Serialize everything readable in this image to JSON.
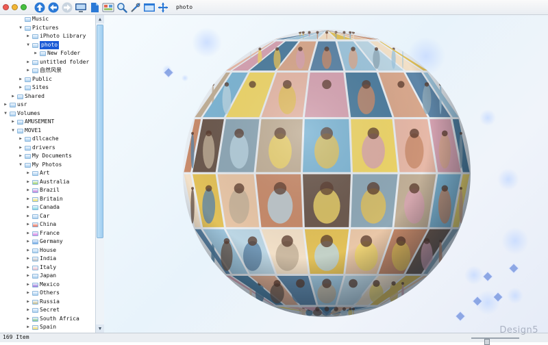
{
  "toolbar": {
    "folder_label": "photo",
    "window_controls": [
      {
        "name": "close-control",
        "color": "#ee5a52"
      },
      {
        "name": "minimize-control",
        "color": "#f2b533"
      },
      {
        "name": "zoom-control",
        "color": "#45c03e"
      }
    ],
    "buttons": [
      {
        "name": "up-arrow-icon",
        "interactable": true
      },
      {
        "name": "back-arrow-icon",
        "interactable": true
      },
      {
        "name": "forward-arrow-icon",
        "interactable": true
      },
      {
        "name": "monitor-view-icon",
        "interactable": true
      },
      {
        "name": "document-view-icon",
        "interactable": true
      },
      {
        "name": "slideshow-icon",
        "interactable": true
      },
      {
        "name": "magnifier-icon",
        "interactable": true
      },
      {
        "name": "tools-icon",
        "interactable": true
      },
      {
        "name": "window-icon",
        "interactable": true
      },
      {
        "name": "expand-icon",
        "interactable": true
      }
    ]
  },
  "tree": {
    "items": [
      {
        "label": "Music",
        "depth": 2,
        "state": "none",
        "color": "#a9cfee"
      },
      {
        "label": "Pictures",
        "depth": 2,
        "state": "expanded",
        "color": "#a9cfee"
      },
      {
        "label": "iPhoto Library",
        "depth": 3,
        "state": "collapsed",
        "color": "#a9cfee"
      },
      {
        "label": "photo",
        "depth": 3,
        "state": "expanded",
        "color": "#a9cfee",
        "selected": true
      },
      {
        "label": "New Folder",
        "depth": 4,
        "state": "collapsed",
        "color": "#a9cfee"
      },
      {
        "label": "untitled folder",
        "depth": 3,
        "state": "collapsed",
        "color": "#a9cfee"
      },
      {
        "label": "自然风景",
        "depth": 3,
        "state": "collapsed",
        "color": "#a9cfee"
      },
      {
        "label": "Public",
        "depth": 2,
        "state": "collapsed",
        "color": "#a9cfee"
      },
      {
        "label": "Sites",
        "depth": 2,
        "state": "collapsed",
        "color": "#a9cfee"
      },
      {
        "label": "Shared",
        "depth": 1,
        "state": "collapsed",
        "color": "#a9cfee"
      },
      {
        "label": "usr",
        "depth": 0,
        "state": "collapsed",
        "color": "#a9cfee"
      },
      {
        "label": "Volumes",
        "depth": 0,
        "state": "expanded",
        "color": "#a9cfee"
      },
      {
        "label": "AMUSEMENT",
        "depth": 1,
        "state": "collapsed",
        "color": "#a9cfee"
      },
      {
        "label": "MOVE1",
        "depth": 1,
        "state": "expanded",
        "color": "#a9cfee"
      },
      {
        "label": "dllcache",
        "depth": 2,
        "state": "collapsed",
        "color": "#a9cfee"
      },
      {
        "label": "drivers",
        "depth": 2,
        "state": "collapsed",
        "color": "#a9cfee"
      },
      {
        "label": "My Documents",
        "depth": 2,
        "state": "collapsed",
        "color": "#a9cfee"
      },
      {
        "label": "My Photos",
        "depth": 2,
        "state": "expanded",
        "color": "#a9cfee"
      },
      {
        "label": "Art",
        "depth": 3,
        "state": "collapsed",
        "color": "#a9cfee"
      },
      {
        "label": "Australia",
        "depth": 3,
        "state": "collapsed",
        "color": "#9fd26a"
      },
      {
        "label": "Brazil",
        "depth": 3,
        "state": "collapsed",
        "color": "#c57ad8"
      },
      {
        "label": "Britain",
        "depth": 3,
        "state": "collapsed",
        "color": "#f0e06a"
      },
      {
        "label": "Canada",
        "depth": 3,
        "state": "collapsed",
        "color": "#7fd6de"
      },
      {
        "label": "Car",
        "depth": 3,
        "state": "collapsed",
        "color": "#a9cfee"
      },
      {
        "label": "China",
        "depth": 3,
        "state": "collapsed",
        "color": "#ef6a4e"
      },
      {
        "label": "France",
        "depth": 3,
        "state": "collapsed",
        "color": "#d97ee0"
      },
      {
        "label": "Germany",
        "depth": 3,
        "state": "collapsed",
        "color": "#6fa8e6"
      },
      {
        "label": "House",
        "depth": 3,
        "state": "collapsed",
        "color": "#a9cfee"
      },
      {
        "label": "India",
        "depth": 3,
        "state": "collapsed",
        "color": "#bfbfbf"
      },
      {
        "label": "Italy",
        "depth": 3,
        "state": "collapsed",
        "color": "#f2c0c8"
      },
      {
        "label": "Japan",
        "depth": 3,
        "state": "collapsed",
        "color": "#a9cfee"
      },
      {
        "label": "Mexico",
        "depth": 3,
        "state": "collapsed",
        "color": "#9a6fd8"
      },
      {
        "label": "Others",
        "depth": 3,
        "state": "collapsed",
        "color": "#a9cfee"
      },
      {
        "label": "Russia",
        "depth": 3,
        "state": "collapsed",
        "color": "#c8bd8a"
      },
      {
        "label": "Secret",
        "depth": 3,
        "state": "collapsed",
        "color": "#a9cfee"
      },
      {
        "label": "South Africa",
        "depth": 3,
        "state": "collapsed",
        "color": "#7fc48a"
      },
      {
        "label": "Spain",
        "depth": 3,
        "state": "collapsed",
        "color": "#f0d86a"
      }
    ]
  },
  "status": {
    "item_count": "169 Item",
    "zoom_level": 0.3,
    "watermark": "Design5"
  },
  "viewer": {
    "tile_palette": [
      "#d9a98e",
      "#7fb7d6",
      "#e9c7a8",
      "#5e86a8",
      "#f0d76a",
      "#c98c6c",
      "#9fc6dd",
      "#e7b9a8",
      "#6d5a4f",
      "#bcd6e4",
      "#d7a4b3",
      "#8fa9b8",
      "#f2e0c8",
      "#4f7fa0",
      "#c2b098",
      "#e3c25a"
    ]
  }
}
